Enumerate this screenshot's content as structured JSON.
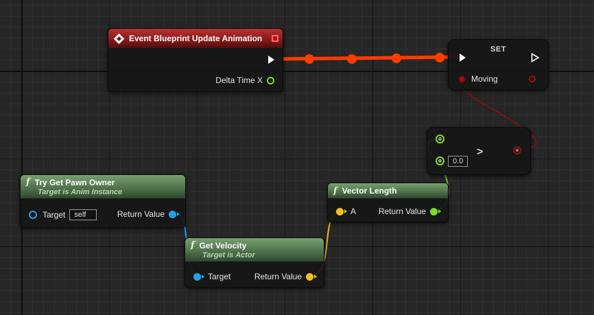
{
  "nodes": {
    "event": {
      "title": "Event Blueprint Update Animation",
      "pin_delta": "Delta Time X"
    },
    "set": {
      "title": "SET",
      "pin_moving": "Moving"
    },
    "compare": {
      "op": ">",
      "value": "0.0"
    },
    "pawn": {
      "title": "Try Get Pawn Owner",
      "subtitle": "Target is Anim Instance",
      "pin_target": "Target",
      "target_value": "self",
      "pin_return": "Return Value"
    },
    "vector_length": {
      "title": "Vector Length",
      "pin_a": "A",
      "pin_return": "Return Value"
    },
    "velocity": {
      "title": "Get Velocity",
      "subtitle": "Target is Actor",
      "pin_target": "Target",
      "pin_return": "Return Value"
    }
  },
  "colors": {
    "exec_wire": "#ff3c00",
    "bool": "#a01010",
    "float": "#7ddc2d",
    "object": "#1fa3e8",
    "vector": "#f0c020",
    "event_header": "#9a2222",
    "function_header": "#4d6e48"
  },
  "icons": {
    "event": "event-diamond-icon",
    "function": "function-f-icon",
    "exec": "exec-arrow-icon"
  }
}
